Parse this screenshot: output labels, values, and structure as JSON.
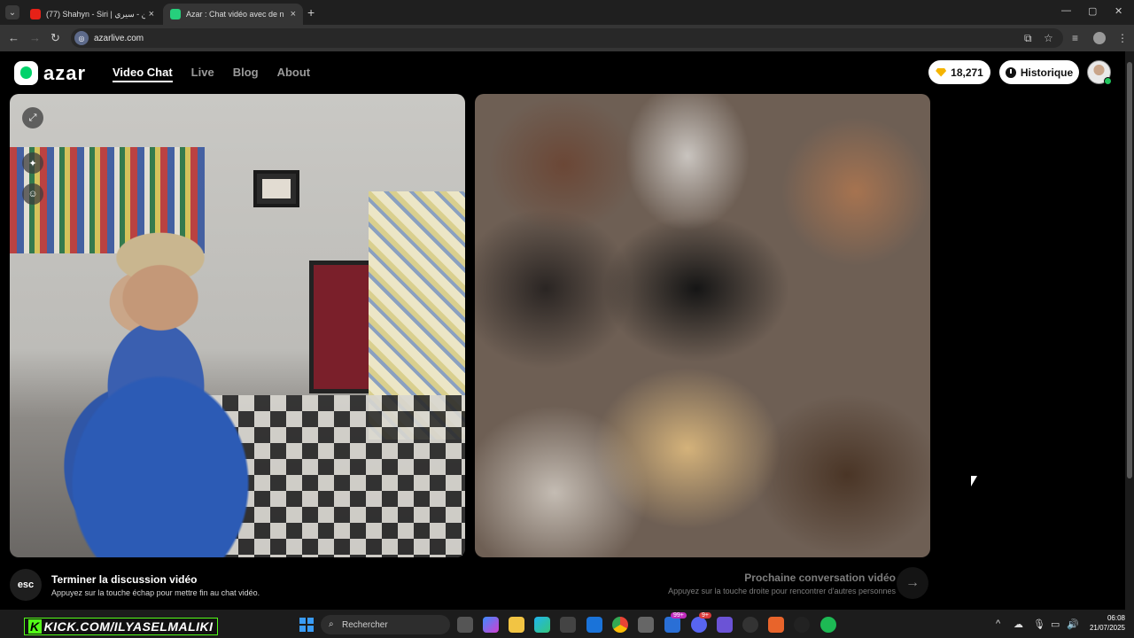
{
  "browser": {
    "tabs": [
      {
        "title": "(77) Shahyn - Siri | شاهين - سيري ",
        "favicon_color": "#e62117"
      },
      {
        "title": "Azar : Chat vidéo avec de n",
        "favicon_color": "#26d07c"
      }
    ],
    "url": "azarlive.com",
    "new_tab_glyph": "+",
    "close_glyph": "×"
  },
  "site": {
    "logo": "azar",
    "nav": [
      {
        "label": "Video Chat",
        "active": true
      },
      {
        "label": "Live",
        "active": false
      },
      {
        "label": "Blog",
        "active": false
      },
      {
        "label": "About",
        "active": false
      }
    ],
    "coins": "18,271",
    "history_label": "Historique"
  },
  "video": {
    "self_tools": [
      "expand-icon",
      "sparkle-effects-icon",
      "sticker-icon"
    ]
  },
  "controls": {
    "end": {
      "key": "esc",
      "title": "Terminer la discussion vidéo",
      "subtitle": "Appuyez sur la touche échap pour mettre fin au chat vidéo."
    },
    "next": {
      "title": "Prochaine conversation vidéo",
      "subtitle": "Appuyez sur la touche droite pour rencontrer d'autres personnes",
      "arrow": "→"
    }
  },
  "taskbar": {
    "overlay": "KICK.COM/ILYASELMALIKI",
    "overlay_k": "K",
    "search_placeholder": "Rechercher",
    "badges": [
      "99+",
      "9+"
    ],
    "time": "06:08",
    "date": "21/07/2025"
  },
  "colors": {
    "accent": "#26d07c",
    "gem": "#f5b400",
    "kick": "#53fc18"
  }
}
